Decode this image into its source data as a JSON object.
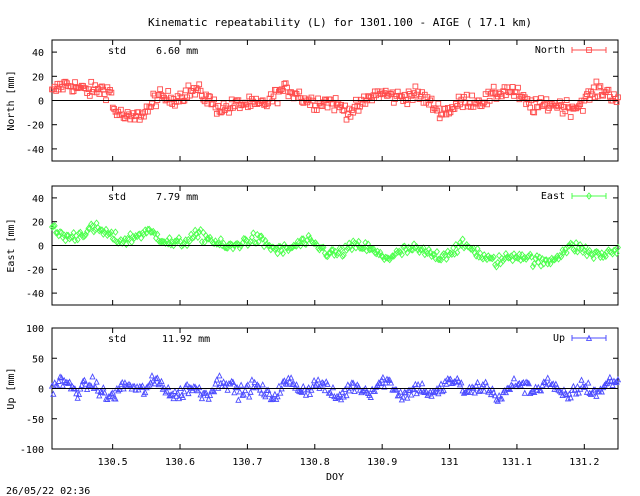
{
  "title": "Kinematic repeatability (L) for 1301.100 - AIGE  ( 17.1 km)",
  "timestamp": "26/05/22 02:36",
  "chart_data": [
    {
      "type": "scatter",
      "panel": "north",
      "series": [
        {
          "name": "North",
          "marker": "square",
          "color": "#ff4c4c"
        }
      ],
      "ylabel": "North [mm]",
      "ylim": [
        -50,
        50
      ],
      "yticks": [
        -40,
        -20,
        0,
        20,
        40
      ],
      "xlim": [
        130.41,
        131.25
      ],
      "std_label": "std",
      "std_value": "6.60 mm",
      "legend_position": "top-right"
    },
    {
      "type": "scatter",
      "panel": "east",
      "series": [
        {
          "name": "East",
          "marker": "diamond",
          "color": "#4cff4c"
        }
      ],
      "ylabel": "East [mm]",
      "ylim": [
        -50,
        50
      ],
      "yticks": [
        -40,
        -20,
        0,
        20,
        40
      ],
      "xlim": [
        130.41,
        131.25
      ],
      "std_label": "std",
      "std_value": "7.79 mm",
      "legend_position": "top-right"
    },
    {
      "type": "scatter",
      "panel": "up",
      "series": [
        {
          "name": "Up",
          "marker": "triangle",
          "color": "#4c4cff"
        }
      ],
      "ylabel": "Up [mm]",
      "ylim": [
        -100,
        100
      ],
      "yticks": [
        -100,
        -50,
        0,
        50,
        100
      ],
      "xlim": [
        130.41,
        131.25
      ],
      "xticks": [
        "130.5",
        "130.6",
        "130.7",
        "130.8",
        "130.9",
        "131",
        "131.1",
        "131.2"
      ],
      "xlabel": "DOY",
      "std_label": "std",
      "std_value": "11.92 mm",
      "legend_position": "top-right"
    }
  ]
}
